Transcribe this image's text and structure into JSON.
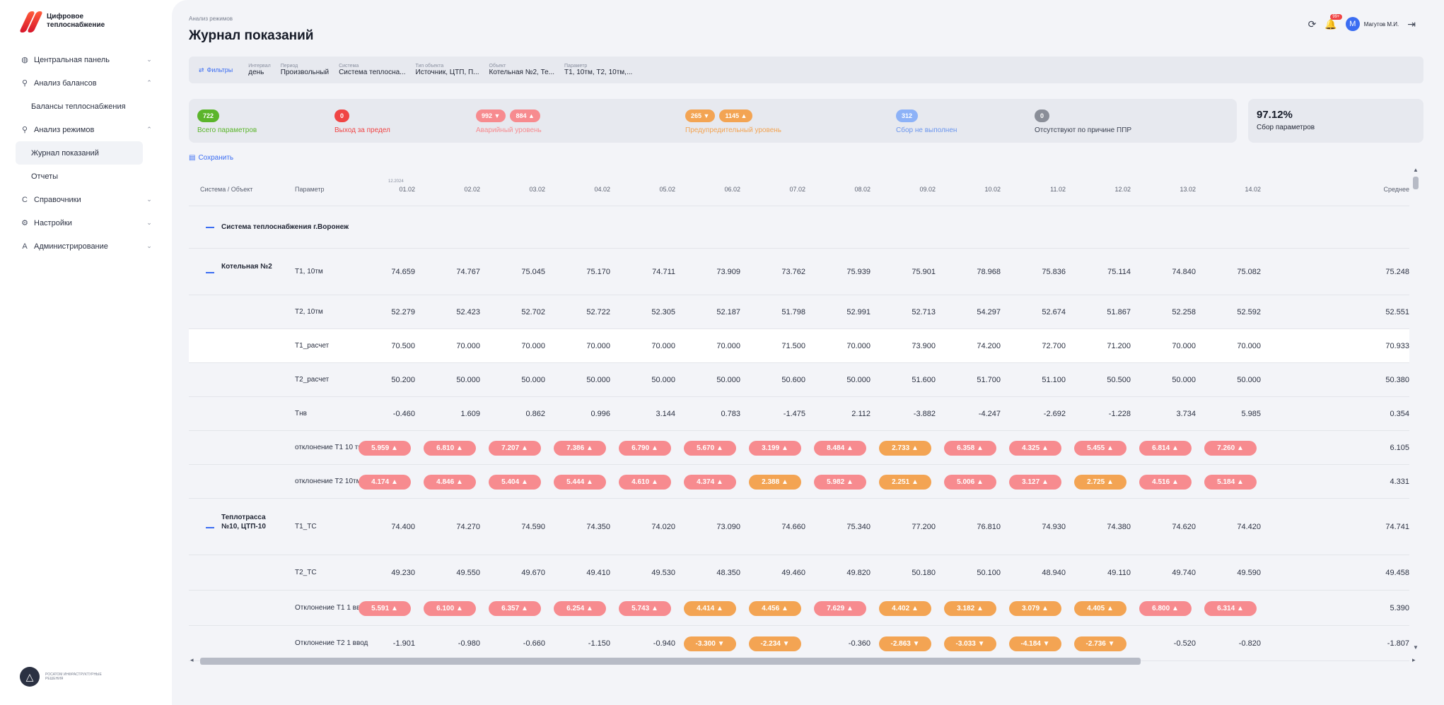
{
  "brand": {
    "line1": "Цифровое",
    "line2": "теплоснабжение"
  },
  "nav": [
    {
      "icon": "dashboard-icon",
      "glyph": "◍",
      "label": "Центральная панель",
      "chev": "⌄"
    },
    {
      "icon": "balance-icon",
      "glyph": "⚲",
      "label": "Анализ балансов",
      "chev": "⌃"
    },
    {
      "sub": true,
      "label": "Балансы теплоснабжения"
    },
    {
      "icon": "modes-icon",
      "glyph": "⚲",
      "label": "Анализ режимов",
      "chev": "⌃"
    },
    {
      "sub": true,
      "label": "Журнал показаний",
      "active": true
    },
    {
      "sub": true,
      "label": "Отчеты"
    },
    {
      "icon": "reference-icon",
      "glyph": "C",
      "label": "Справочники",
      "chev": "⌄"
    },
    {
      "icon": "settings-icon",
      "glyph": "⚙",
      "label": "Настройки",
      "chev": "⌄"
    },
    {
      "icon": "admin-icon",
      "glyph": "A",
      "label": "Администрирование",
      "chev": "⌄"
    }
  ],
  "footer": {
    "text": "РОСАТОМ ИНФРАСТРУКТУРНЫЕ РЕШЕНИЯ"
  },
  "header": {
    "breadcrumb": "Анализ режимов",
    "title": "Журнал показаний",
    "notif_badge": "99+",
    "user": "Магутов М.И.",
    "avatar": "M"
  },
  "filters": {
    "button": "Фильтры",
    "items": [
      {
        "label": "Интервал",
        "value": "день"
      },
      {
        "label": "Период",
        "value": "Произвольный"
      },
      {
        "label": "Система",
        "value": "Система теплосна..."
      },
      {
        "label": "Тип объекта",
        "value": "Источник, ЦТП, П..."
      },
      {
        "label": "Объект",
        "value": "Котельная №2, Те..."
      },
      {
        "label": "Параметр",
        "value": "Т1, 10тм, Т2, 10тм,..."
      }
    ]
  },
  "summary": {
    "total": {
      "value": "722",
      "label": "Всего параметров",
      "color": "#5bb52b"
    },
    "limit": {
      "value": "0",
      "label": "Выход за предел",
      "color": "#f04545"
    },
    "alarm": {
      "values": [
        "992 ▼",
        "884 ▲"
      ],
      "label": "Аварийный уровень",
      "color": "#f78b8f"
    },
    "warn": {
      "values": [
        "265 ▼",
        "1145 ▲"
      ],
      "label": "Предупредительный уровень",
      "color": "#f3a453"
    },
    "notdone": {
      "value": "312",
      "label": "Сбор не выполнен",
      "color": "#8db2f7"
    },
    "ppr": {
      "value": "0",
      "label": "Отсутствуют по причине ППР",
      "color": "#8a8e98"
    },
    "collection": {
      "value": "97.12%",
      "label": "Сбор параметров"
    }
  },
  "save_label": "Сохранить",
  "table": {
    "col_system": "Система / Объект",
    "col_param": "Параметр",
    "year": "12.2024",
    "dates": [
      "01.02",
      "02.02",
      "03.02",
      "04.02",
      "05.02",
      "06.02",
      "07.02",
      "08.02",
      "09.02",
      "10.02",
      "11.02",
      "12.02",
      "13.02",
      "14.02"
    ],
    "col_avg": "Среднее",
    "system_name": "Система теплоснабжения г.Воронеж",
    "objects": [
      {
        "name": "Котельная №2",
        "rows": [
          {
            "param": "Т1, 10тм",
            "values": [
              "74.659",
              "74.767",
              "75.045",
              "75.170",
              "74.711",
              "73.909",
              "73.762",
              "75.939",
              "75.901",
              "78.968",
              "75.836",
              "75.114",
              "74.840",
              "75.082"
            ],
            "avg": "75.248"
          },
          {
            "param": "Т2, 10тм",
            "values": [
              "52.279",
              "52.423",
              "52.702",
              "52.722",
              "52.305",
              "52.187",
              "51.798",
              "52.991",
              "52.713",
              "54.297",
              "52.674",
              "51.867",
              "52.258",
              "52.592"
            ],
            "avg": "52.551"
          },
          {
            "param": "Т1_расчет",
            "values": [
              "70.500",
              "70.000",
              "70.000",
              "70.000",
              "70.000",
              "70.000",
              "71.500",
              "70.000",
              "73.900",
              "74.200",
              "72.700",
              "71.200",
              "70.000",
              "70.000"
            ],
            "avg": "70.933",
            "highlight": true
          },
          {
            "param": "Т2_расчет",
            "values": [
              "50.200",
              "50.000",
              "50.000",
              "50.000",
              "50.000",
              "50.000",
              "50.600",
              "50.000",
              "51.600",
              "51.700",
              "51.100",
              "50.500",
              "50.000",
              "50.000"
            ],
            "avg": "50.380"
          },
          {
            "param": "Тнв",
            "values": [
              "-0.460",
              "1.609",
              "0.862",
              "0.996",
              "3.144",
              "0.783",
              "-1.475",
              "2.112",
              "-3.882",
              "-4.247",
              "-2.692",
              "-1.228",
              "3.734",
              "5.985"
            ],
            "avg": "0.354"
          },
          {
            "param": "отклонение Т1 10 тм",
            "pill": true,
            "values": [
              "5.959 ▲",
              "6.810 ▲",
              "7.207 ▲",
              "7.386 ▲",
              "6.790 ▲",
              "5.670 ▲",
              "3.199 ▲",
              "8.484 ▲",
              "2.733 ▲",
              "6.358 ▲",
              "4.325 ▲",
              "5.455 ▲",
              "6.814 ▲",
              "7.260 ▲"
            ],
            "colors": [
              "red",
              "red",
              "red",
              "red",
              "red",
              "red",
              "red",
              "red",
              "orange",
              "red",
              "red",
              "red",
              "red",
              "red"
            ],
            "avg": "6.105"
          },
          {
            "param": "отклонение Т2 10тм",
            "pill": true,
            "values": [
              "4.174 ▲",
              "4.846 ▲",
              "5.404 ▲",
              "5.444 ▲",
              "4.610 ▲",
              "4.374 ▲",
              "2.388 ▲",
              "5.982 ▲",
              "2.251 ▲",
              "5.006 ▲",
              "3.127 ▲",
              "2.725 ▲",
              "4.516 ▲",
              "5.184 ▲"
            ],
            "colors": [
              "red",
              "red",
              "red",
              "red",
              "red",
              "red",
              "orange",
              "red",
              "orange",
              "red",
              "red",
              "orange",
              "red",
              "red"
            ],
            "avg": "4.331"
          }
        ]
      },
      {
        "name": "Теплотрасса №10, ЦТП-10",
        "rows": [
          {
            "param": "Т1_ТС",
            "values": [
              "74.400",
              "74.270",
              "74.590",
              "74.350",
              "74.020",
              "73.090",
              "74.660",
              "75.340",
              "77.200",
              "76.810",
              "74.930",
              "74.380",
              "74.620",
              "74.420"
            ],
            "avg": "74.741"
          },
          {
            "param": "Т2_ТС",
            "values": [
              "49.230",
              "49.550",
              "49.670",
              "49.410",
              "49.530",
              "48.350",
              "49.460",
              "49.820",
              "50.180",
              "50.100",
              "48.940",
              "49.110",
              "49.740",
              "49.590"
            ],
            "avg": "49.458"
          },
          {
            "param": "Отклонение Т1 1 ввод",
            "pill": true,
            "values": [
              "5.591 ▲",
              "6.100 ▲",
              "6.357 ▲",
              "6.254 ▲",
              "5.743 ▲",
              "4.414 ▲",
              "4.456 ▲",
              "7.629 ▲",
              "4.402 ▲",
              "3.182 ▲",
              "3.079 ▲",
              "4.405 ▲",
              "6.800 ▲",
              "6.314 ▲"
            ],
            "colors": [
              "red",
              "red",
              "red",
              "red",
              "red",
              "orange",
              "orange",
              "red",
              "orange",
              "orange",
              "orange",
              "orange",
              "red",
              "red"
            ],
            "avg": "5.390"
          },
          {
            "param": "Отклонение Т2 1 ввод",
            "pill": true,
            "values": [
              "-1.901",
              "-0.980",
              "-0.660",
              "-1.150",
              "-0.940",
              "-3.300 ▼",
              "-2.234 ▼",
              "-0.360",
              "-2.863 ▼",
              "-3.033 ▼",
              "-4.184 ▼",
              "-2.736 ▼",
              "-0.520",
              "-0.820"
            ],
            "colors": [
              "",
              "",
              "",
              "",
              "",
              "orange",
              "orange",
              "",
              "orange",
              "orange",
              "orange",
              "orange",
              "",
              ""
            ],
            "avg": "-1.807"
          }
        ]
      }
    ]
  }
}
